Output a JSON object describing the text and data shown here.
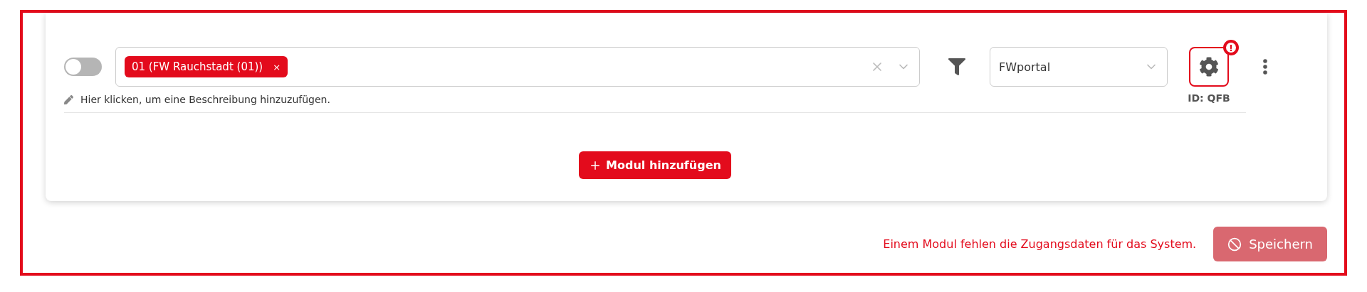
{
  "module": {
    "enabled": false,
    "units": [
      {
        "label": "01 (FW Rauchstadt (01))",
        "remove": "×"
      }
    ],
    "system": {
      "value": "FWportal"
    },
    "settings": {
      "warning": true,
      "badge": "!",
      "id_label": "ID: QFB"
    },
    "description_hint": "Hier klicken, um eine Beschreibung hinzuzufügen."
  },
  "add_button": "Modul hinzufügen",
  "footer": {
    "error": "Einem Modul fehlen die Zugangsdaten für das System.",
    "save_button": "Speichern",
    "save_disabled": true
  }
}
